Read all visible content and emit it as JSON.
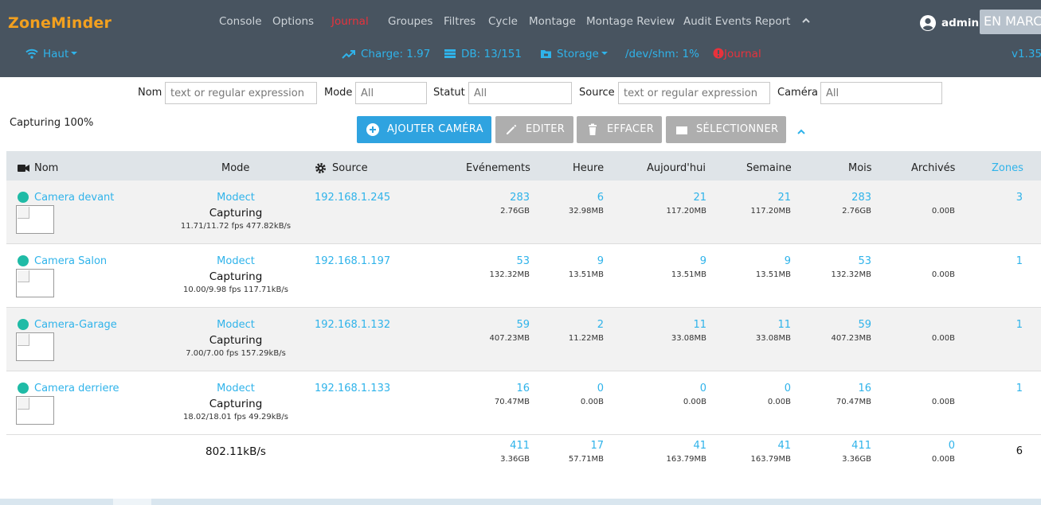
{
  "app": {
    "brand": "ZoneMinder"
  },
  "nav": {
    "items": [
      "Console",
      "Options",
      "Journal",
      "Groupes",
      "Filtres",
      "Cycle",
      "Montage",
      "Montage Review",
      "Audit Events Report"
    ],
    "active": "Journal",
    "user": "admin",
    "run_state": "EN MARCHE"
  },
  "subnav": {
    "group": "Haut",
    "load": "Charge: 1.97",
    "db": "DB: 13/151",
    "storage": "Storage",
    "shm": "/dev/shm: 1%",
    "log": "Journal",
    "version": "v1.35"
  },
  "filters": {
    "name_label": "Nom",
    "name_placeholder": "text or regular expression",
    "mode_label": "Mode",
    "mode_value": "All",
    "status_label": "Statut",
    "status_value": "All",
    "source_label": "Source",
    "source_placeholder": "text or regular expression",
    "camera_label": "Caméra",
    "camera_value": "All"
  },
  "capture_status": "Capturing 100%",
  "buttons": {
    "add": "AJOUTER CAMÉRA",
    "edit": "EDITER",
    "delete": "EFFACER",
    "select": "SÉLECTIONNER"
  },
  "table": {
    "headers": {
      "name": "Nom",
      "mode": "Mode",
      "source": "Source",
      "events": "Evénements",
      "hour": "Heure",
      "today": "Aujourd'hui",
      "week": "Semaine",
      "month": "Mois",
      "archived": "Archivés",
      "zones": "Zones"
    },
    "rows": [
      {
        "name": "Camera devant",
        "function": "Modect",
        "state": "Capturing",
        "fps": "11.71/11.72 fps 477.82kB/s",
        "source": "192.168.1.245",
        "events": "283",
        "events_size": "2.76GB",
        "hour": "6",
        "hour_size": "32.98MB",
        "today": "21",
        "today_size": "117.20MB",
        "week": "21",
        "week_size": "117.20MB",
        "month": "283",
        "month_size": "2.76GB",
        "archived_size": "0.00B",
        "zones": "3"
      },
      {
        "name": "Camera Salon",
        "function": "Modect",
        "state": "Capturing",
        "fps": "10.00/9.98 fps 117.71kB/s",
        "source": "192.168.1.197",
        "events": "53",
        "events_size": "132.32MB",
        "hour": "9",
        "hour_size": "13.51MB",
        "today": "9",
        "today_size": "13.51MB",
        "week": "9",
        "week_size": "13.51MB",
        "month": "53",
        "month_size": "132.32MB",
        "archived_size": "0.00B",
        "zones": "1"
      },
      {
        "name": "Camera-Garage",
        "function": "Modect",
        "state": "Capturing",
        "fps": "7.00/7.00 fps 157.29kB/s",
        "source": "192.168.1.132",
        "events": "59",
        "events_size": "407.23MB",
        "hour": "2",
        "hour_size": "11.22MB",
        "today": "11",
        "today_size": "33.08MB",
        "week": "11",
        "week_size": "33.08MB",
        "month": "59",
        "month_size": "407.23MB",
        "archived_size": "0.00B",
        "zones": "1"
      },
      {
        "name": "Camera derriere",
        "function": "Modect",
        "state": "Capturing",
        "fps": "18.02/18.01 fps 49.29kB/s",
        "source": "192.168.1.133",
        "events": "16",
        "events_size": "70.47MB",
        "hour": "0",
        "hour_size": "0.00B",
        "today": "0",
        "today_size": "0.00B",
        "week": "0",
        "week_size": "0.00B",
        "month": "16",
        "month_size": "70.47MB",
        "archived_size": "0.00B",
        "zones": "1"
      }
    ],
    "totals": {
      "bandwidth": "802.11kB/s",
      "events": "411",
      "events_size": "3.36GB",
      "hour": "17",
      "hour_size": "57.71MB",
      "today": "41",
      "today_size": "163.79MB",
      "week": "41",
      "week_size": "163.79MB",
      "month": "411",
      "month_size": "3.36GB",
      "archived": "0",
      "archived_size": "0.00B",
      "zones": "6"
    }
  },
  "colors": {
    "navbar": "#485460",
    "brand": "#f2a01f",
    "accent": "#2fb3ea",
    "danger": "#e8323c",
    "status_ok": "#1fbba6"
  }
}
